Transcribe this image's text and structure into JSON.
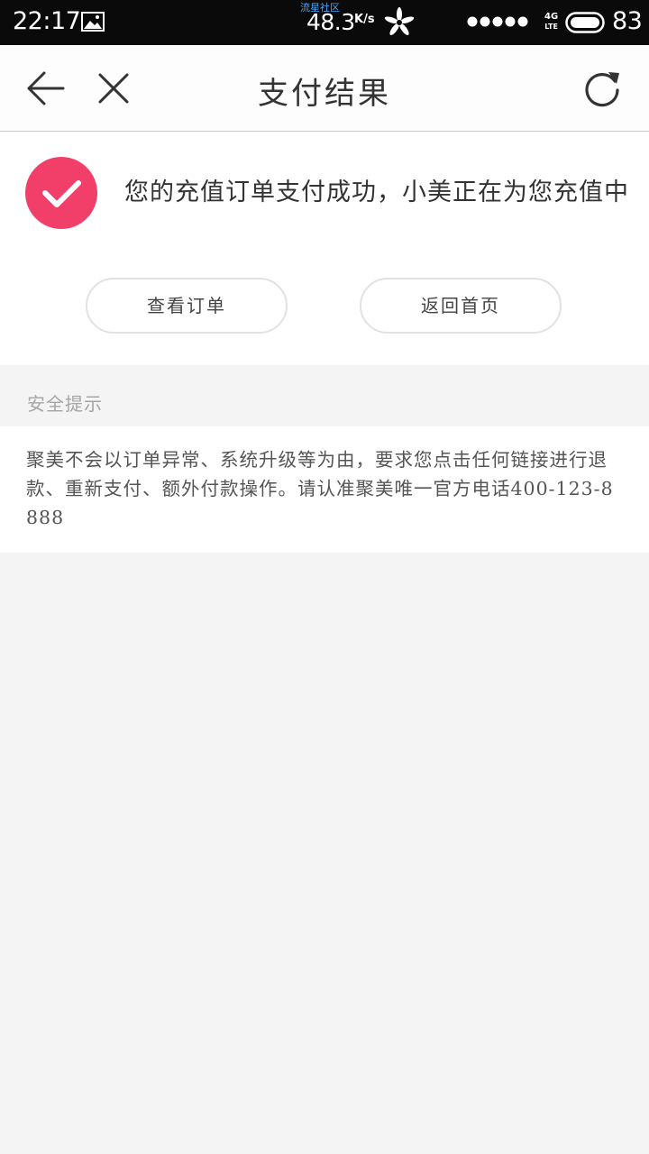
{
  "status_bar": {
    "time": "22:17",
    "carrier_label": "流星社区",
    "net_speed": "48.3",
    "net_speed_unit": "K/s",
    "network_type_top": "4G",
    "network_type_bottom": "LTE",
    "battery_level": "83",
    "icons": [
      "image-icon",
      "flower-icon",
      "signal-dots-icon",
      "battery-icon"
    ]
  },
  "header": {
    "title": "支付结果",
    "icons": [
      "back-arrow-icon",
      "close-icon",
      "refresh-icon"
    ]
  },
  "result": {
    "icon": "check-circle-icon",
    "accent_color": "#f23f6a",
    "message": "您的充值订单支付成功，小美正在为您充值中",
    "view_order_label": "查看订单",
    "back_home_label": "返回首页"
  },
  "safety_tips": {
    "heading": "安全提示",
    "body": "聚美不会以订单异常、系统升级等为由，要求您点击任何链接进行退款、重新支付、额外付款操作。请认准聚美唯一官方电话400-123-8888"
  }
}
